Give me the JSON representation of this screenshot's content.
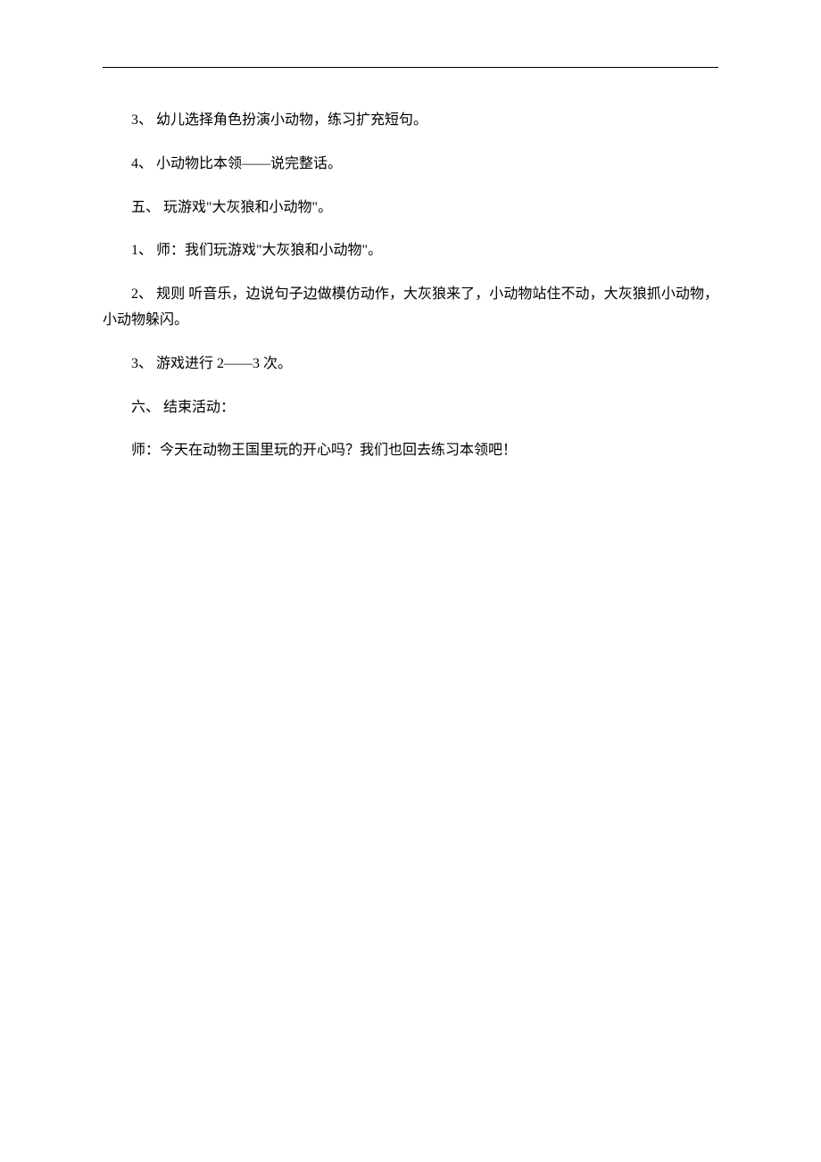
{
  "paragraphs": [
    "3、  幼儿选择角色扮演小动物，练习扩充短句。",
    "4、  小动物比本领——说完整话。",
    "五、  玩游戏\"大灰狼和小动物\"。",
    "1、  师：我们玩游戏\"大灰狼和小动物\"。",
    "2、  规则  听音乐，边说句子边做模仿动作，大灰狼来了，小动物站住不动，大灰狼抓小动物，小动物躲闪。",
    "3、  游戏进行 2——3 次。",
    "六、  结束活动：",
    "师：今天在动物王国里玩的开心吗？我们也回去练习本领吧！"
  ]
}
